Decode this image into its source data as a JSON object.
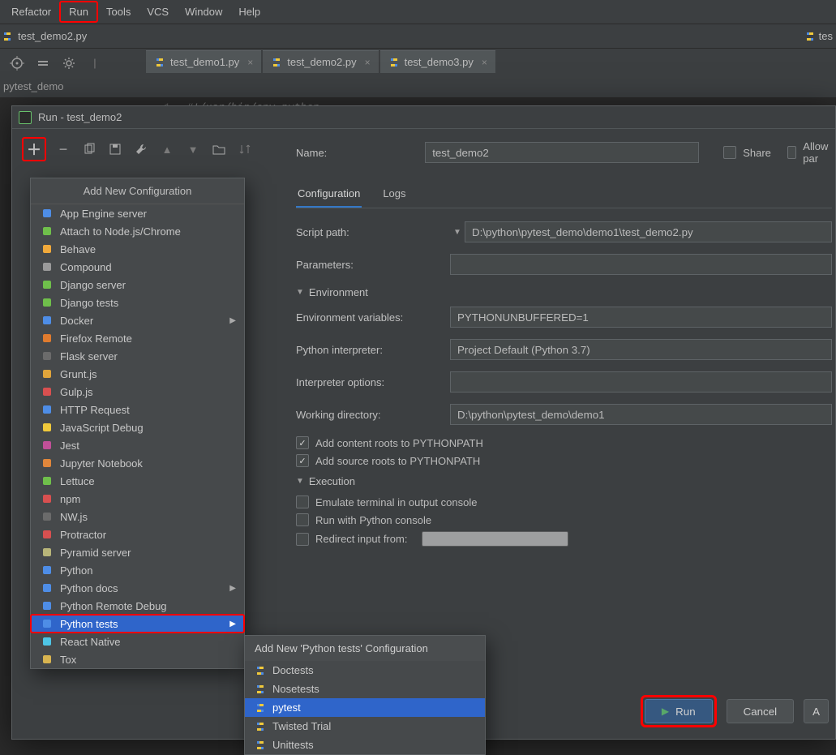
{
  "menubar": {
    "items": [
      "Refactor",
      "Run",
      "Tools",
      "VCS",
      "Window",
      "Help"
    ]
  },
  "open_file_tab": "test_demo2.py",
  "right_truncated_tab": "tes",
  "editor_tabs": [
    {
      "label": "test_demo1.py"
    },
    {
      "label": "test_demo2.py"
    },
    {
      "label": "test_demo3.py"
    }
  ],
  "breadcrumb": "pytest_demo",
  "editor": {
    "lineno": "1",
    "text": "#!/usr/bin/env python"
  },
  "dialog": {
    "title": "Run - test_demo2",
    "name_label": "Name:",
    "name_value": "test_demo2",
    "share_label": "Share",
    "allow_label": "Allow par",
    "tabs": {
      "configuration": "Configuration",
      "logs": "Logs"
    },
    "fields": {
      "script_label": "Script path:",
      "script_value": "D:\\python\\pytest_demo\\demo1\\test_demo2.py",
      "parameters_label": "Parameters:",
      "env_header": "Environment",
      "envvars_label": "Environment variables:",
      "envvars_value": "PYTHONUNBUFFERED=1",
      "interp_label": "Python interpreter:",
      "interp_value": "Project Default (Python 3.7)",
      "interpopts_label": "Interpreter options:",
      "workdir_label": "Working directory:",
      "workdir_value": "D:\\python\\pytest_demo\\demo1",
      "contentroots": "Add content roots to PYTHONPATH",
      "sourceroots": "Add source roots to PYTHONPATH",
      "exec_header": "Execution",
      "emulate": "Emulate terminal in output console",
      "pyconsole": "Run with Python console",
      "redirect": "Redirect input from:"
    },
    "buttons": {
      "run": "Run",
      "cancel": "Cancel",
      "apply": "A"
    }
  },
  "add_config": {
    "header": "Add New Configuration",
    "items": [
      "App Engine server",
      "Attach to Node.js/Chrome",
      "Behave",
      "Compound",
      "Django server",
      "Django tests",
      "Docker",
      "Firefox Remote",
      "Flask server",
      "Grunt.js",
      "Gulp.js",
      "HTTP Request",
      "JavaScript Debug",
      "Jest",
      "Jupyter Notebook",
      "Lettuce",
      "npm",
      "NW.js",
      "Protractor",
      "Pyramid server",
      "Python",
      "Python docs",
      "Python Remote Debug",
      "Python tests",
      "React Native",
      "Tox"
    ],
    "expand_for": [
      "Docker",
      "Python docs",
      "Python tests"
    ]
  },
  "submenu": {
    "header": "Add New 'Python tests' Configuration",
    "items": [
      "Doctests",
      "Nosetests",
      "pytest",
      "Twisted Trial",
      "Unittests"
    ],
    "selected": "pytest"
  },
  "icon_colors": {
    "app_engine": "#4e8de6",
    "attach": "#6fbf4b",
    "behave": "#f0a93b",
    "compound": "#9a9a9a",
    "django": "#6fbf4b",
    "docker": "#4e8de6",
    "firefox": "#e07b2e",
    "flask": "#6b6b6b",
    "grunt": "#e0a53b",
    "gulp": "#d85050",
    "http": "#4e8de6",
    "js": "#f0c93b",
    "jest": "#c15098",
    "jupyter": "#e0863b",
    "lettuce": "#6fbf4b",
    "npm": "#d85050",
    "nw": "#6b6b6b",
    "protractor": "#d85050",
    "pyramid": "#b8b579",
    "python": "#4e8de6",
    "react": "#4ec5e6",
    "tox": "#d8b450"
  }
}
